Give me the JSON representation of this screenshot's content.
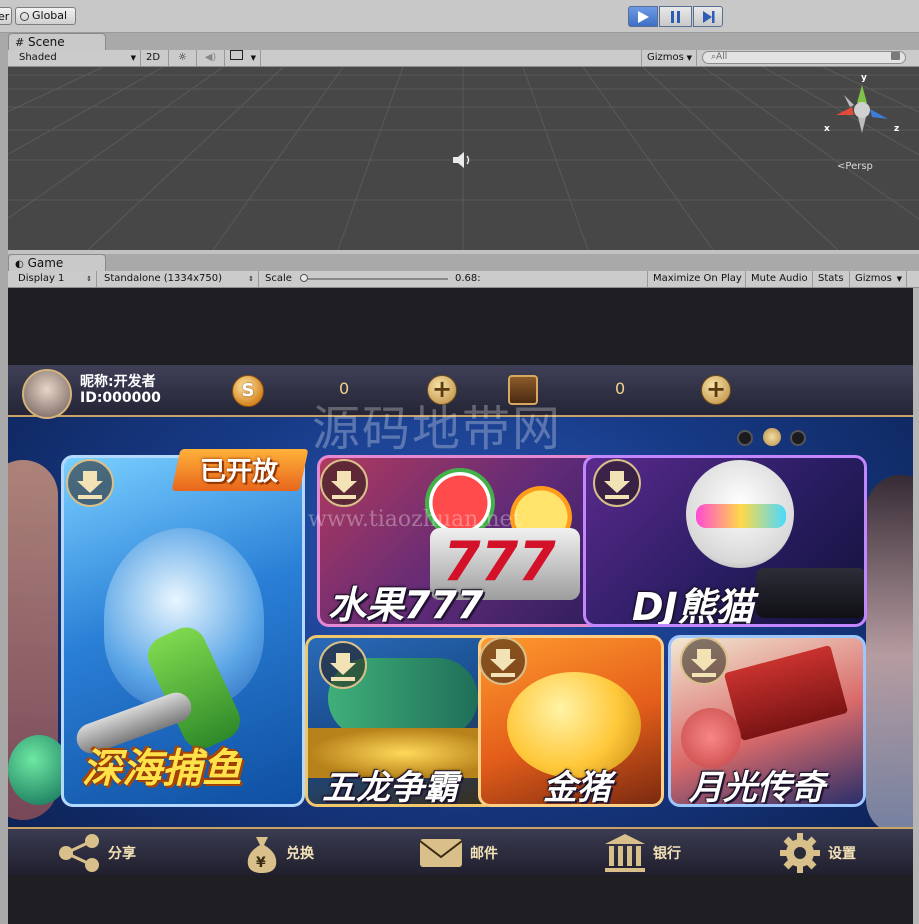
{
  "toolbar": {
    "left_partial": "er",
    "global_label": "Global"
  },
  "scene_panel": {
    "tab_label": "Scene",
    "shading_mode": "Shaded",
    "mode_2d": "2D",
    "gizmos_label": "Gizmos",
    "search_placeholder": "All",
    "persp_label": "Persp",
    "axis_y": "y",
    "axis_x": "x",
    "axis_z": "z"
  },
  "game_panel": {
    "tab_label": "Game",
    "display": "Display 1",
    "resolution": "Standalone (1334x750)",
    "scale_label": "Scale",
    "scale_value": "0.68:",
    "scale_level": 0.0,
    "maximize_on_play": "Maximize On Play",
    "mute_audio": "Mute Audio",
    "stats": "Stats",
    "gizmos": "Gizmos"
  },
  "game": {
    "nickname": "昵称:开发者",
    "user_id": "ID:000000",
    "gold_value": "0",
    "card_value": "0",
    "watermark_cn": "源码地带网",
    "watermark_url": "www.tiaozhuan.net",
    "page_dots": 3,
    "active_dot": 1,
    "open_badge": "已开放",
    "games": [
      {
        "title": "深海捕鱼"
      },
      {
        "title": "水果777"
      },
      {
        "title": "DJ熊猫"
      },
      {
        "title": "五龙争霸"
      },
      {
        "title": "金猪"
      },
      {
        "title": "月光传奇"
      }
    ],
    "bottom_nav": [
      {
        "label": "分享",
        "icon": "share-icon"
      },
      {
        "label": "兑换",
        "icon": "money-bag-icon"
      },
      {
        "label": "邮件",
        "icon": "mail-icon"
      },
      {
        "label": "银行",
        "icon": "bank-icon"
      },
      {
        "label": "设置",
        "icon": "gear-icon"
      }
    ]
  },
  "colors": {
    "play_active": "#4a7fd1",
    "gold": "#e0b45a",
    "editor_bg": "#c2c2c2"
  }
}
